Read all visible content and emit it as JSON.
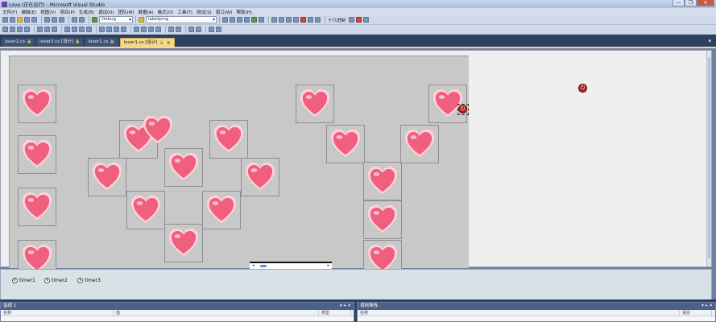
{
  "window": {
    "title": "Love (正在运行) - Microsoft Visual Studio",
    "min_label": "—",
    "max_label": "❐",
    "close_label": "✕"
  },
  "menu": [
    "文件(F)",
    "编辑(E)",
    "视图(V)",
    "项目(P)",
    "生成(B)",
    "调试(D)",
    "团队(M)",
    "数据(A)",
    "格式(O)",
    "工具(T)",
    "测试(S)",
    "窗口(W)",
    "帮助(H)"
  ],
  "toolbar": {
    "config_combo": "Debug",
    "find_combo": "labelping",
    "hex_label": "十六进制"
  },
  "tabs": [
    {
      "label": "lover2.cs",
      "lock": "🔒",
      "active": false
    },
    {
      "label": "lover2.cs [设计]",
      "lock": "🔒",
      "active": false
    },
    {
      "label": "lover1.cs",
      "lock": "🔒",
      "active": false
    },
    {
      "label": "lover1.cs [设计]",
      "lock": "🔒",
      "active": true
    }
  ],
  "icons": {
    "heart": "heart-icon",
    "power": "power-icon",
    "clock": "clock-icon"
  },
  "colors": {
    "heart_fill": "#f0607e",
    "heart_glow": "#ffd3dc",
    "power": "#b2231f",
    "active_tab": "#f3d98c"
  },
  "tray": {
    "timers": [
      "timer1",
      "timer2",
      "timer3"
    ]
  },
  "panels": {
    "watch": {
      "title": "监视 1",
      "col_name": "名称",
      "col_value": "值",
      "col_type": "类型"
    },
    "callstack": {
      "title": "调用堆栈",
      "col_name": "名称",
      "col_lang": "语言"
    },
    "pin_glyph": "▾ ⌖ ✕"
  }
}
